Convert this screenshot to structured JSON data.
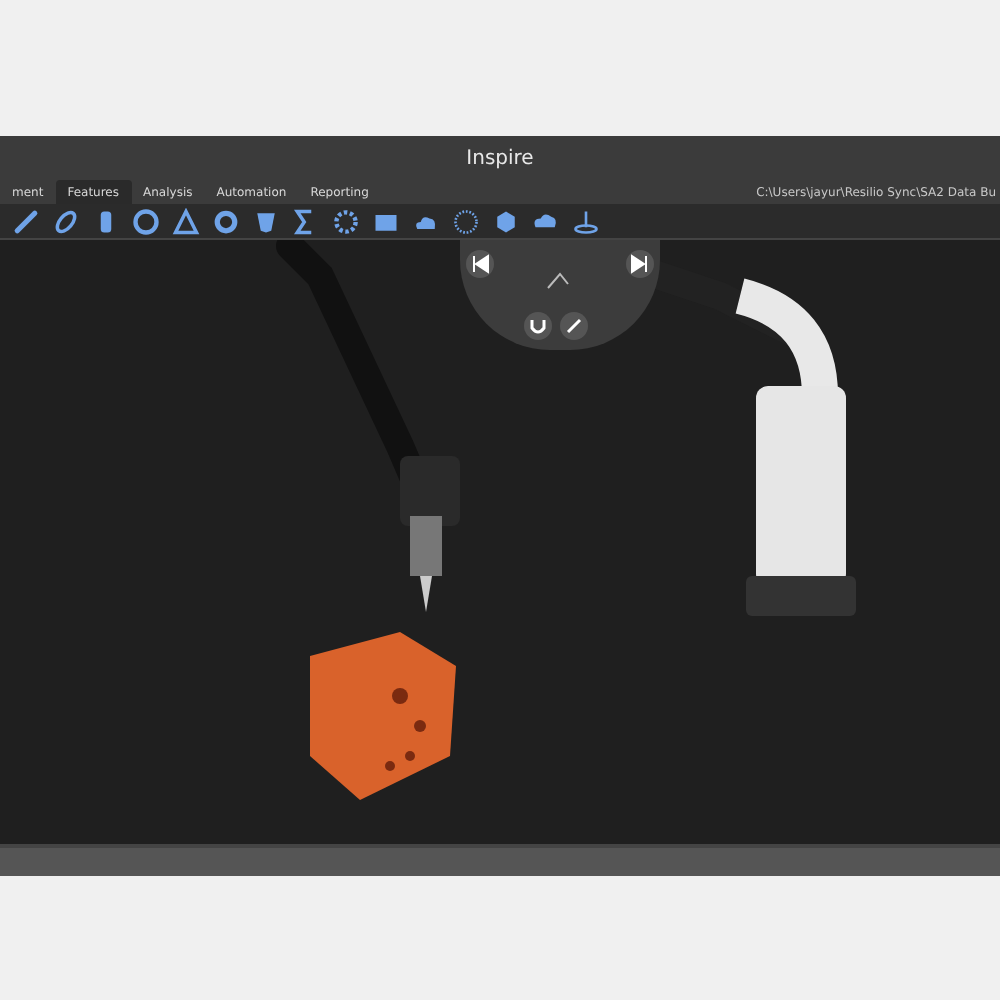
{
  "window": {
    "title": "Inspire"
  },
  "tabs": [
    {
      "label": "ment",
      "selected": false
    },
    {
      "label": "Features",
      "selected": true
    },
    {
      "label": "Analysis",
      "selected": false
    },
    {
      "label": "Automation",
      "selected": false
    },
    {
      "label": "Reporting",
      "selected": false
    }
  ],
  "file_path": "C:\\Users\\jayur\\Resilio Sync\\SA2 Data Bu"
}
